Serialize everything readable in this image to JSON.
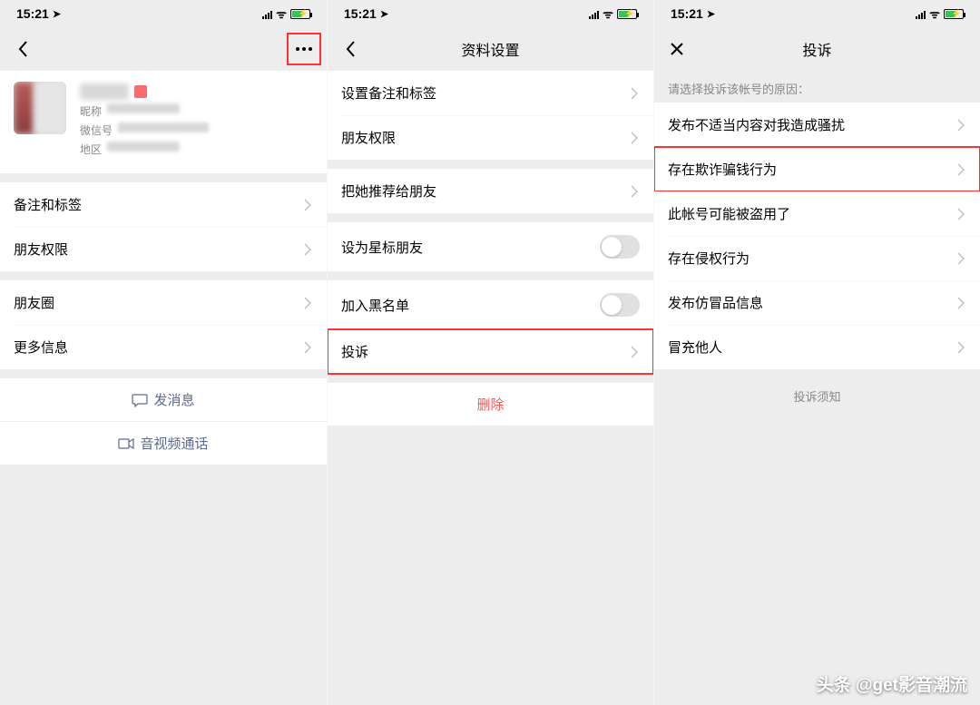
{
  "status": {
    "time": "15:21"
  },
  "screen1": {
    "profile": {
      "nickname_label": "昵称",
      "wechat_label": "微信号",
      "region_label": "地区"
    },
    "items": {
      "remark": "备注和标签",
      "permission": "朋友权限",
      "moments": "朋友圈",
      "more": "更多信息"
    },
    "actions": {
      "message": "发消息",
      "call": "音视频通话"
    }
  },
  "screen2": {
    "title": "资料设置",
    "items": {
      "remark": "设置备注和标签",
      "permission": "朋友权限",
      "recommend": "把她推荐给朋友",
      "star": "设为星标朋友",
      "blacklist": "加入黑名单",
      "complaint": "投诉"
    },
    "delete": "删除"
  },
  "screen3": {
    "title": "投诉",
    "prompt": "请选择投诉该帐号的原因：",
    "reasons": {
      "harass": "发布不适当内容对我造成骚扰",
      "fraud": "存在欺诈骗钱行为",
      "stolen": "此帐号可能被盗用了",
      "infringe": "存在侵权行为",
      "fake": "发布仿冒品信息",
      "impersonate": "冒充他人"
    },
    "notice": "投诉须知"
  },
  "watermark": "头条 @get影音潮流"
}
